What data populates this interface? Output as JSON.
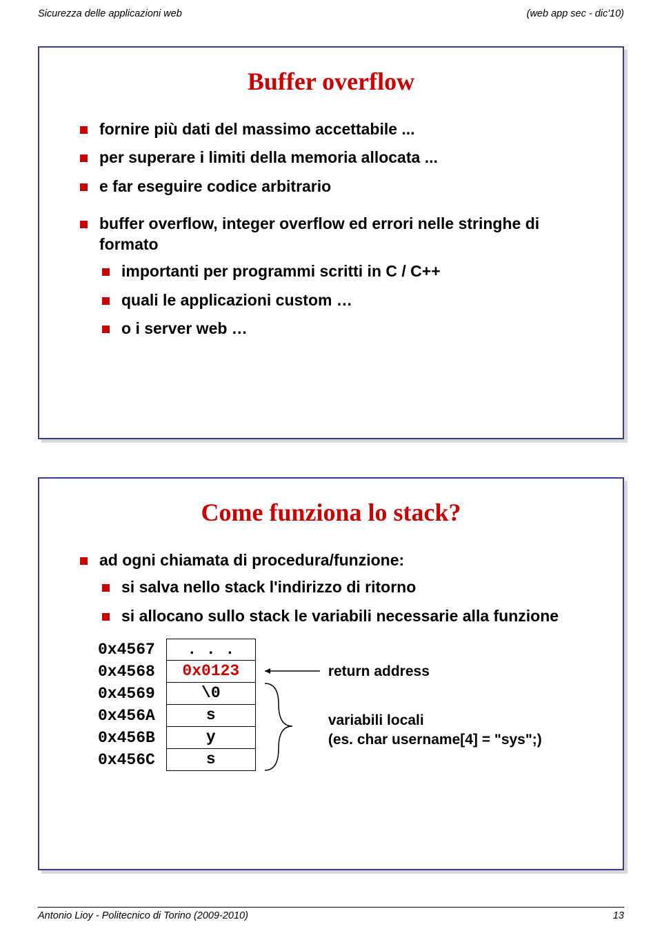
{
  "header": {
    "left": "Sicurezza delle applicazioni web",
    "right": "(web app sec - dic'10)"
  },
  "footer": {
    "left": "Antonio Lioy - Politecnico di Torino (2009-2010)",
    "right": "13"
  },
  "slide1": {
    "title": "Buffer overflow",
    "b1": "fornire più dati del massimo accettabile ...",
    "b2": "per superare i limiti della memoria allocata ...",
    "b3": "e far eseguire codice arbitrario",
    "b4": "buffer overflow, integer overflow ed errori nelle stringhe di formato",
    "s1": "importanti per programmi scritti in C / C++",
    "s2": "quali le applicazioni custom …",
    "s3": "o i server web …"
  },
  "slide2": {
    "title": "Come funziona lo stack?",
    "b1": "ad ogni chiamata di procedura/funzione:",
    "s1": "si salva nello stack l'indirizzo di ritorno",
    "s2": "si allocano sullo stack le variabili necessarie alla funzione",
    "addrs": {
      "a0": "0x4567",
      "a1": "0x4568",
      "a2": "0x4569",
      "a3": "0x456A",
      "a4": "0x456B",
      "a5": "0x456C"
    },
    "cells": {
      "c0": ". . .",
      "c1": "0x0123",
      "c2": "\\0",
      "c3": "s",
      "c4": "y",
      "c5": "s"
    },
    "ann_return": "return address",
    "ann_locals_l1": "variabili locali",
    "ann_locals_l2": "(es. char username[4] = \"sys\";)"
  }
}
